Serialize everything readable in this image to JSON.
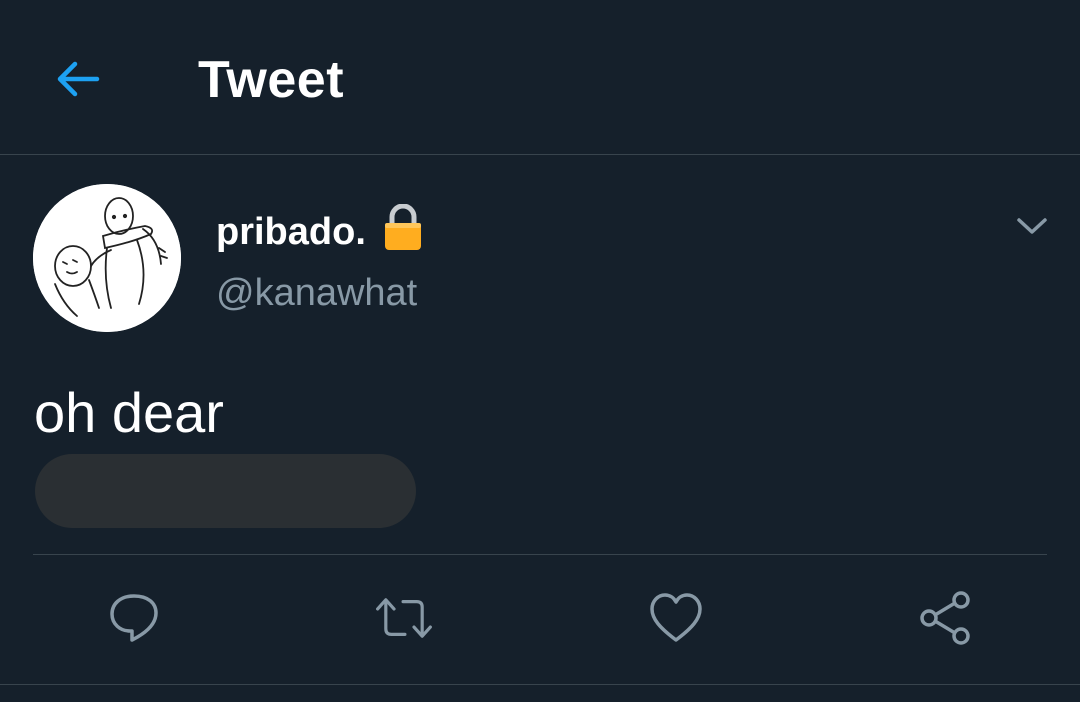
{
  "header": {
    "title": "Tweet",
    "back_icon": "arrow-left-icon"
  },
  "tweet": {
    "display_name": "pribado.",
    "handle": "@kanawhat",
    "text": "oh dear",
    "protected_icon": "lock-icon",
    "menu_icon": "chevron-down-icon"
  },
  "actions": [
    {
      "icon": "reply-icon"
    },
    {
      "icon": "retweet-icon"
    },
    {
      "icon": "like-icon"
    },
    {
      "icon": "share-icon"
    }
  ],
  "colors": {
    "background": "#15202b",
    "accent": "#1da1f2",
    "secondary_text": "#8899a6",
    "divider": "#38444d",
    "lock": "#ffad1f"
  }
}
